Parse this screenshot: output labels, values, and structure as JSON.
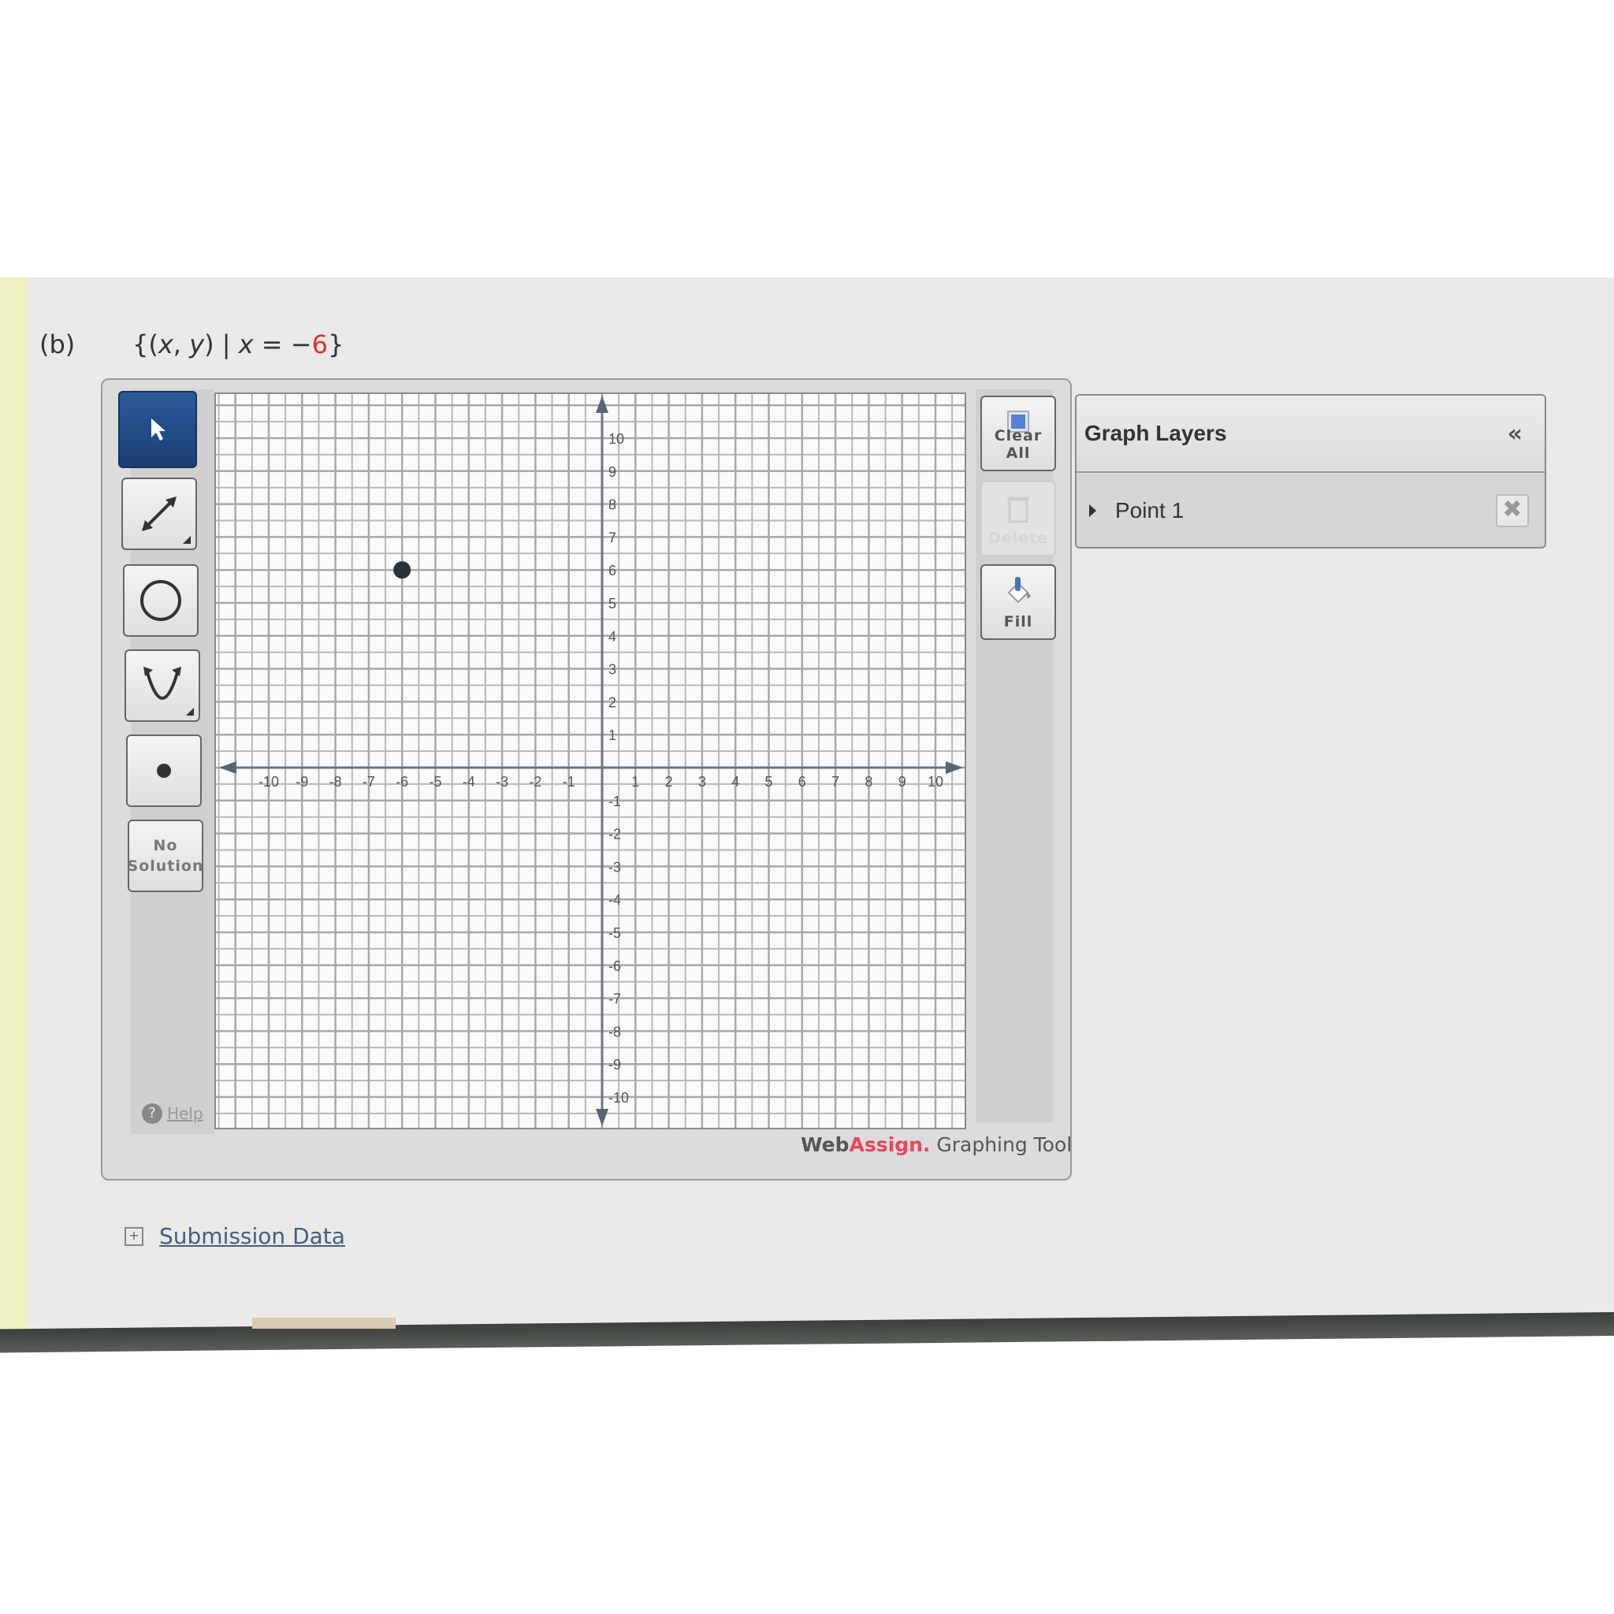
{
  "question": {
    "part_label": "(b)",
    "set_prefix": "{(",
    "var_x": "x",
    "comma": ", ",
    "var_y": "y",
    "mid": ") | ",
    "var_x2": "x",
    "equals": " = −",
    "value": "6",
    "close": "}",
    "value_color": "#dd3333"
  },
  "toolbar": {
    "tools": [
      {
        "name": "select",
        "icon": "pointer-arrow-icon",
        "active": true
      },
      {
        "name": "line",
        "icon": "line-arrow-icon",
        "active": false
      },
      {
        "name": "circle",
        "icon": "circle-icon",
        "active": false
      },
      {
        "name": "parabola",
        "icon": "parabola-icon",
        "active": false
      },
      {
        "name": "point",
        "icon": "point-icon",
        "active": false
      }
    ],
    "no_solution_line1": "No",
    "no_solution_line2": "Solution",
    "help_label": "Help",
    "active_color": "#1f4680"
  },
  "right_tools": {
    "clear_all_label": "Clear All",
    "delete_label": "Delete",
    "fill_label": "Fill"
  },
  "branding": {
    "web": "Web",
    "assign": "Assign.",
    "suffix": " Graphing Tool",
    "accent": "#e8485a"
  },
  "layers_panel": {
    "title": "Graph Layers",
    "collapse_icon": "«",
    "items": [
      {
        "label": "Point 1",
        "delete_icon": "✖"
      }
    ]
  },
  "submission": {
    "expand_icon": "+",
    "link_label": "Submission Data"
  },
  "chart_data": {
    "type": "scatter",
    "title": "",
    "xlabel": "",
    "ylabel": "",
    "xlim": [
      -11,
      11
    ],
    "ylim": [
      -11,
      11
    ],
    "grid": true,
    "x_ticks": [
      -10,
      -9,
      -8,
      -7,
      -6,
      -5,
      -4,
      -3,
      -2,
      -1,
      1,
      2,
      3,
      4,
      5,
      6,
      7,
      8,
      9,
      10
    ],
    "y_ticks": [
      10,
      9,
      8,
      7,
      6,
      5,
      4,
      3,
      2,
      1,
      -1,
      -2,
      -3,
      -4,
      -5,
      -6,
      -7,
      -8,
      -9,
      -10
    ],
    "points": [
      {
        "name": "Point 1",
        "x": -6,
        "y": 6
      }
    ]
  }
}
